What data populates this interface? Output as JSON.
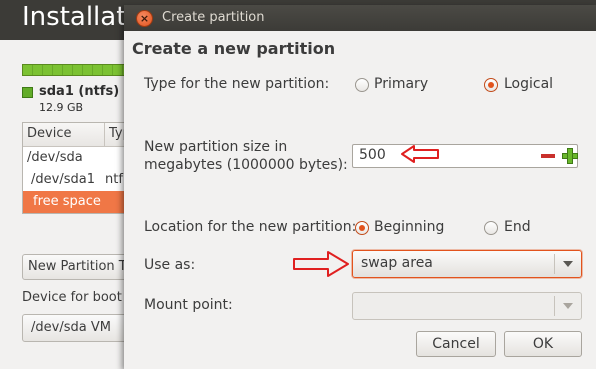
{
  "background": {
    "title": "Installation",
    "disk": {
      "name": "sda1 (ntfs)",
      "size": "12.9 GB"
    },
    "table": {
      "headers": [
        "Device",
        "Typ"
      ],
      "rows": [
        {
          "device": "/dev/sda",
          "type": ""
        },
        {
          "device": "/dev/sda1",
          "type": "ntf"
        },
        {
          "device": "free space",
          "type": ""
        }
      ]
    },
    "new_partition_button": "New Partition T",
    "bootloader_label": "Device for boot",
    "bootloader_value": "/dev/sda   VM"
  },
  "dialog": {
    "title": "Create partition",
    "close_icon": "close-icon",
    "heading": "Create a new partition",
    "type": {
      "label": "Type for the new partition:",
      "options": [
        "Primary",
        "Logical"
      ],
      "selected": "Logical"
    },
    "size": {
      "label_line1": "New partition size in",
      "label_line2": "megabytes (1000000 bytes):",
      "value": "500"
    },
    "location": {
      "label": "Location for the new partition:",
      "options": [
        "Beginning",
        "End"
      ],
      "selected": "Beginning"
    },
    "use_as": {
      "label": "Use as:",
      "value": "swap area"
    },
    "mount_point": {
      "label": "Mount point:",
      "value": ""
    },
    "buttons": {
      "cancel": "Cancel",
      "ok": "OK"
    }
  },
  "colors": {
    "accent": "#e2531d",
    "selection": "#f07746",
    "titlebar": "#3c3b37",
    "annotation_arrow": "#e02020"
  }
}
